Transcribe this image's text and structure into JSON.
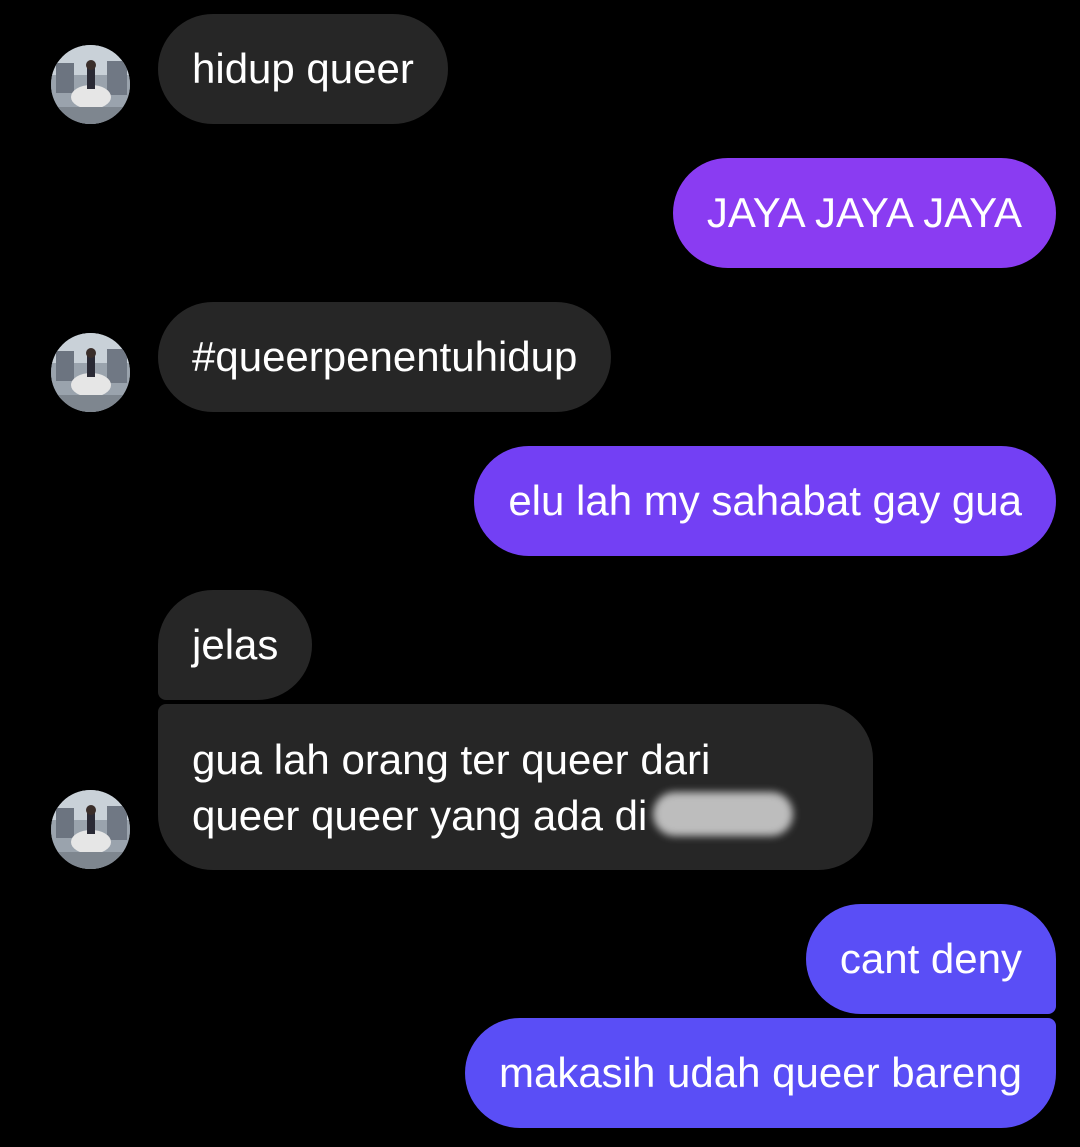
{
  "messages": {
    "m1": {
      "text": "hidup queer"
    },
    "m2": {
      "text": "JAYA JAYA JAYA"
    },
    "m3": {
      "text": "#queerpenentuhidup"
    },
    "m4": {
      "text": "elu lah my sahabat gay gua"
    },
    "m5": {
      "text": "jelas"
    },
    "m6": {
      "line1": "gua lah orang ter queer dari",
      "line2": "queer queer yang ada di"
    },
    "m7": {
      "text": "cant deny"
    },
    "m8": {
      "text": "makasih udah queer bareng"
    }
  },
  "colors": {
    "background": "#000000",
    "incoming_bubble": "#262626",
    "outgoing_top": "#8a3cf2",
    "outgoing_mid": "#7340f4",
    "outgoing_bottom": "#5a4ef6"
  },
  "icons": {
    "avatar": "contact-avatar-photo"
  }
}
